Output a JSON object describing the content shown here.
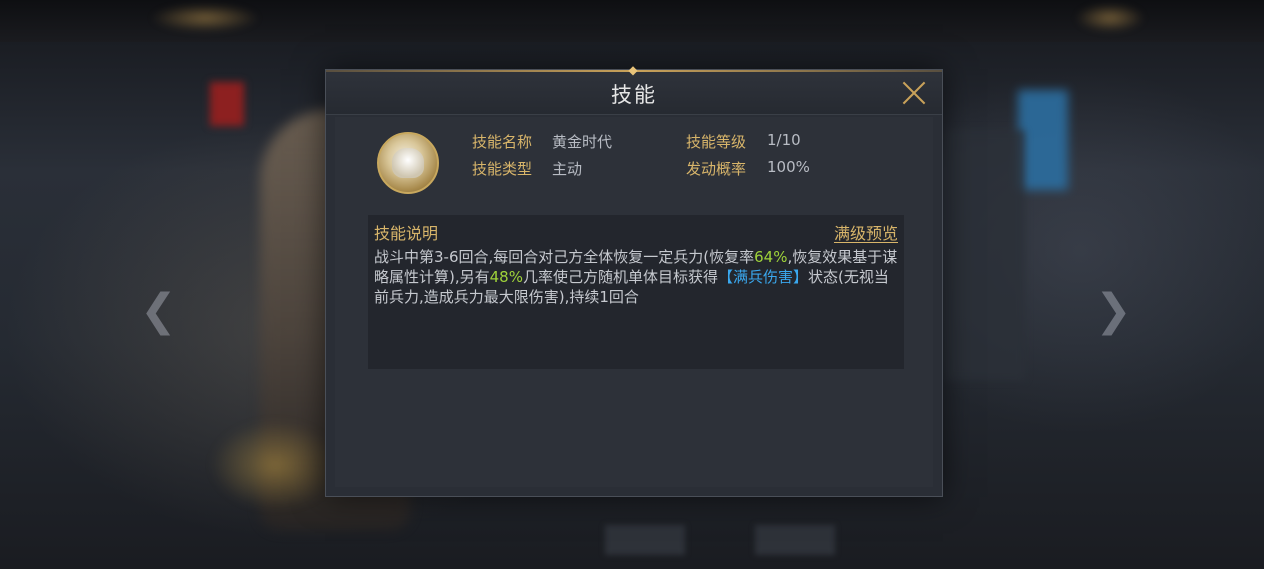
{
  "dialog": {
    "title": "技能",
    "skill": {
      "name_label": "技能名称",
      "name_value": "黄金时代",
      "type_label": "技能类型",
      "type_value": "主动",
      "level_label": "技能等级",
      "level_value": "1/10",
      "chance_label": "发动概率",
      "chance_value": "100%"
    },
    "description": {
      "heading": "技能说明",
      "preview_link": "满级预览",
      "text_1": "战斗中第3-6回合,每回合对己方全体恢复一定兵力(恢复率",
      "value_1": "64%",
      "text_2": ",恢复效果基于谋略属性计算),另有",
      "value_2": "48%",
      "text_3": "几率使己方随机单体目标获得",
      "status_name": "【满兵伤害】",
      "text_4": "状态(无视当前兵力,造成兵力最大限伤害),持续1回合"
    }
  },
  "icons": {
    "close": "close-icon",
    "skill": "golden-age-skill-icon",
    "nav_left": "chevron-left-icon",
    "nav_right": "chevron-right-icon"
  },
  "colors": {
    "gold": "#d8b56a",
    "green": "#9fd33a",
    "blue": "#3aa8ee"
  }
}
